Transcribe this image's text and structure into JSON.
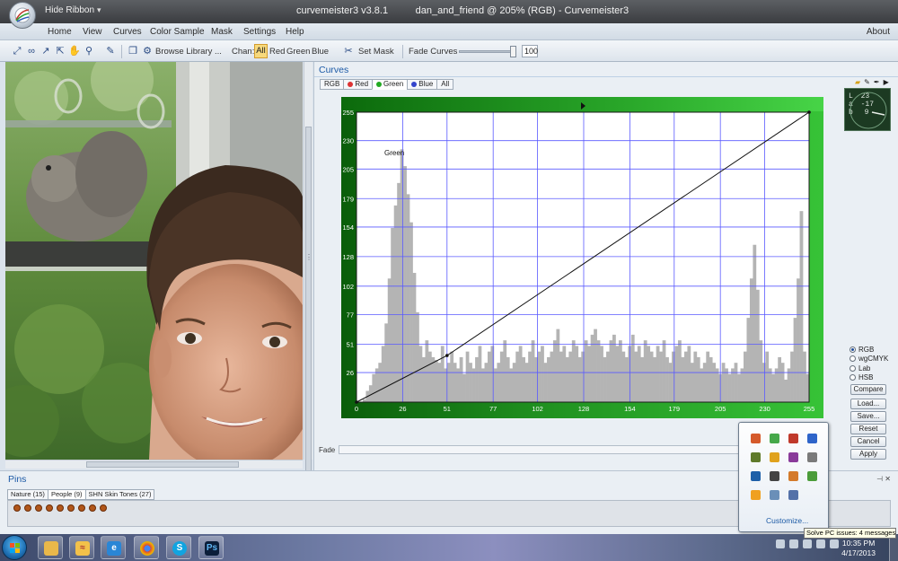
{
  "window": {
    "title_left": "curvemeister3 v3.8.1",
    "title_right": "dan_and_friend @ 205% (RGB) - Curvemeister3",
    "hide_ribbon": "Hide Ribbon"
  },
  "menu": {
    "items": [
      "Home",
      "View",
      "Curves",
      "Color Sample",
      "Mask",
      "Settings",
      "Help"
    ],
    "about": "About"
  },
  "toolbar": {
    "browse_library": "Browse Library ...",
    "chan_label": "Chan:",
    "channels": [
      "All",
      "Red",
      "Green",
      "Blue"
    ],
    "set_mask": "Set Mask",
    "fade_curves": "Fade Curves",
    "fade_value": "100"
  },
  "curves": {
    "panel_title": "Curves",
    "tabs": [
      "RGB",
      "Red",
      "Green",
      "Blue",
      "All"
    ],
    "active_tab": "Green",
    "graph_label": "Green",
    "fade_label": "Fade"
  },
  "chart_data": {
    "type": "line",
    "title": "Green",
    "xlim": [
      0,
      255
    ],
    "ylim": [
      0,
      255
    ],
    "x_ticks": [
      0,
      26,
      51,
      77,
      102,
      128,
      154,
      179,
      205,
      230,
      255
    ],
    "y_ticks": [
      26,
      51,
      77,
      102,
      128,
      154,
      179,
      205,
      230,
      255
    ],
    "grid": true,
    "curve_points": [
      [
        0,
        0
      ],
      [
        51,
        41
      ],
      [
        255,
        255
      ]
    ],
    "histogram": [
      0,
      0,
      1,
      4,
      6,
      10,
      12,
      14,
      20,
      28,
      44,
      62,
      70,
      78,
      90,
      84,
      74,
      64,
      46,
      32,
      20,
      16,
      22,
      18,
      16,
      15,
      14,
      20,
      12,
      14,
      18,
      14,
      12,
      16,
      10,
      18,
      14,
      12,
      16,
      20,
      12,
      14,
      18,
      20,
      12,
      14,
      18,
      22,
      16,
      12,
      14,
      18,
      20,
      16,
      14,
      18,
      22,
      16,
      18,
      20,
      14,
      16,
      18,
      22,
      26,
      18,
      20,
      16,
      18,
      22,
      20,
      16,
      18,
      22,
      20,
      24,
      26,
      22,
      20,
      16,
      18,
      22,
      24,
      20,
      22,
      18,
      16,
      20,
      24,
      18,
      20,
      16,
      22,
      20,
      18,
      16,
      20,
      18,
      22,
      16,
      14,
      18,
      20,
      22,
      16,
      18,
      20,
      14,
      18,
      16,
      12,
      14,
      18,
      16,
      14,
      12,
      10,
      14,
      12,
      10,
      12,
      14,
      10,
      12,
      18,
      30,
      44,
      56,
      40,
      22,
      14,
      18,
      12,
      10,
      12,
      16,
      14,
      8,
      12,
      18,
      30,
      44,
      68,
      18,
      10
    ],
    "histogram_unit": "relative height (0-100)"
  },
  "lab_readout": {
    "L": "23",
    "a": "-17",
    "b": "9"
  },
  "color_mode": {
    "options": [
      "RGB",
      "wgCMYK",
      "Lab",
      "HSB"
    ],
    "selected": "RGB"
  },
  "buttons": {
    "compare": "Compare",
    "load": "Load...",
    "save": "Save...",
    "reset": "Reset",
    "cancel": "Cancel",
    "apply": "Apply"
  },
  "pins": {
    "title": "Pins",
    "tabs": [
      "Nature (15)",
      "People (9)",
      "SHN Skin Tones (27)"
    ],
    "active_tab": "People (9)",
    "pin_count": 9
  },
  "tray_popup": {
    "customize": "Customize...",
    "tooltip": "Solve PC issues: 4 messages"
  },
  "taskbar": {
    "time": "10:35 PM",
    "date": "4/17/2013"
  },
  "colors": {
    "curve_bg_dark": "#0a5d0a",
    "curve_bg_light": "#37c337",
    "grid_line": "#5a5aff",
    "histogram": "#b4b4b4",
    "accent_blue": "#1c5aa6"
  }
}
